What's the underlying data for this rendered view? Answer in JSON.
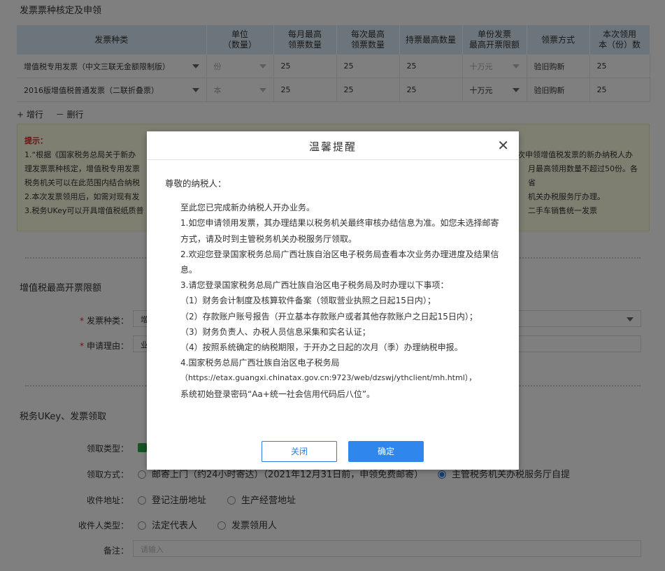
{
  "sections": {
    "invoice_title": "发票票种核定及申领",
    "limit_title": "增值税最高开票限额",
    "ukey_title": "税务UKey、发票领取"
  },
  "invoice_table": {
    "headers": [
      "发票种类",
      "单位\n（数量）",
      "每月最高\n领票数量",
      "每次最高\n领票数量",
      "持票最高数量",
      "单份发票\n最高开票限额",
      "领票方式",
      "本次领用\n本（份）数"
    ],
    "rows": [
      {
        "type": "增值税专用发票（中文三联无金额限制版）",
        "unit": "份",
        "monthly": "25",
        "each": "25",
        "hold": "25",
        "limit": "十万元",
        "method": "验旧购新",
        "count": "25"
      },
      {
        "type": "2016版增值税普通发票（二联折叠票）",
        "unit": "本",
        "monthly": "25",
        "each": "25",
        "hold": "25",
        "limit": "十万元",
        "method": "验旧购新",
        "count": "25"
      }
    ],
    "add_row": "+ 增行",
    "del_row": "－ 删行"
  },
  "tips": {
    "title": "提示：",
    "line1a": "1.“根据《国家税务总局关于新办",
    "line1b": "次申领增值税发票的新办纳税人办",
    "line2a": "理发票票种核定，增值税专用发票",
    "line2b": "月最高领用数量不超过50份。各省",
    "line3a": "税务机关可以在此范围内结合纳税",
    "line4a": "2.本次发票领用后，如需对现有发",
    "line4b": "机关办税服务厅办理。",
    "line5a": "3.税务UKey可以开具增值税纸质普",
    "line5b": "二手车销售统一发票"
  },
  "limit_form": {
    "invoice_type_label": "发票种类：",
    "invoice_type_value": "增",
    "reason_label": "申请理由：",
    "reason_value": "业"
  },
  "ukey_form": {
    "pickup_type_label": "领取类型：",
    "pickup_method_label": "领取方式：",
    "pickup_method_opt1": "邮寄上门（约24小时寄达）（2021年12月31日前，申领免费邮寄）",
    "pickup_method_opt2": "主管税务机关办税服务厅自提",
    "address_label": "收件地址：",
    "address_opt1": "登记注册地址",
    "address_opt2": "生产经营地址",
    "recipient_label": "收件人类型：",
    "recipient_opt1": "法定代表人",
    "recipient_opt2": "发票领用人",
    "remark_label": "备注：",
    "remark_placeholder": "请输入"
  },
  "modal": {
    "title": "温馨提醒",
    "close_symbol": "✕",
    "greeting": "尊敬的纳税人：",
    "lines": [
      "至此您已完成新办纳税人开办业务。",
      "1.如您申请领用发票，其办理结果以税务机关最终审核办结信息为准。如您未选择邮寄方式，请及时到主管税务机关办税服务厅领取。",
      "2.欢迎您登录国家税务总局广西壮族自治区电子税务局查看本次业务办理进度及结果信息。",
      "3.请您登录国家税务总局广西壮族自治区电子税务局及时办理以下事项：",
      "（1）财务会计制度及核算软件备案（领取营业执照之日起15日内）；",
      "（2）存款账户账号报告（开立基本存款账户或者其他存款账户之日起15日内）；",
      "（3）财务负责人、办税人员信息采集和实名认证；",
      "（4）按照系统确定的纳税期限，于开办之日起的次月（季）办理纳税申报。",
      "4.国家税务总局广西壮族自治区电子税务局",
      "（https://etax.guangxi.chinatax.gov.cn:9723/web/dzswj/ythclient/mh.html），",
      "系统初始登录密码“Aa+统一社会信用代码后八位”。"
    ],
    "cancel_label": "关闭",
    "ok_label": "确定"
  }
}
